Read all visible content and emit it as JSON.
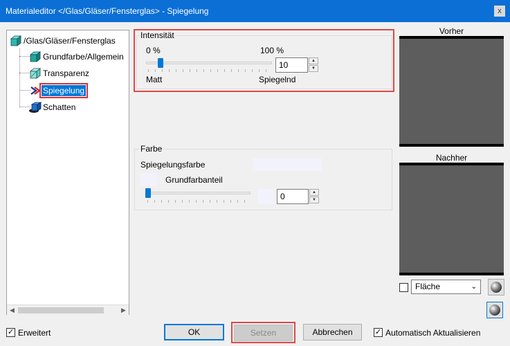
{
  "window": {
    "title": "Materialeditor  </Glas/Gläser/Fensterglas> - Spiegelung",
    "close_glyph": "x"
  },
  "tree": {
    "root": "/Glas/Gläser/Fensterglas",
    "items": [
      {
        "label": "Grundfarbe/Allgemein"
      },
      {
        "label": "Transparenz"
      },
      {
        "label": "Spiegelung",
        "selected": true
      },
      {
        "label": "Schatten"
      }
    ]
  },
  "intensity": {
    "title": "Intensität",
    "min_label": "0 %",
    "max_label": "100 %",
    "left_label": "Matt",
    "right_label": "Spiegelnd",
    "value": "10",
    "slider_fraction": 0.1
  },
  "color": {
    "title": "Farbe",
    "reflection_color_label": "Spiegelungsfarbe",
    "base_color_share_label": "Grundfarbanteil",
    "value": "0",
    "slider_fraction": 0.0
  },
  "previews": {
    "before_label": "Vorher",
    "after_label": "Nachher",
    "surface_select_value": "Fläche"
  },
  "bottom": {
    "extended_label": "Erweitert",
    "extended_checked": true,
    "ok_label": "OK",
    "apply_label": "Setzen",
    "cancel_label": "Abbrechen",
    "auto_update_label": "Automatisch Aktualisieren",
    "auto_update_checked": true
  },
  "colors": {
    "titlebar": "#0b6fd6",
    "selection": "#0078d7",
    "highlight": "#e04848",
    "preview": "#5d5d5d"
  }
}
